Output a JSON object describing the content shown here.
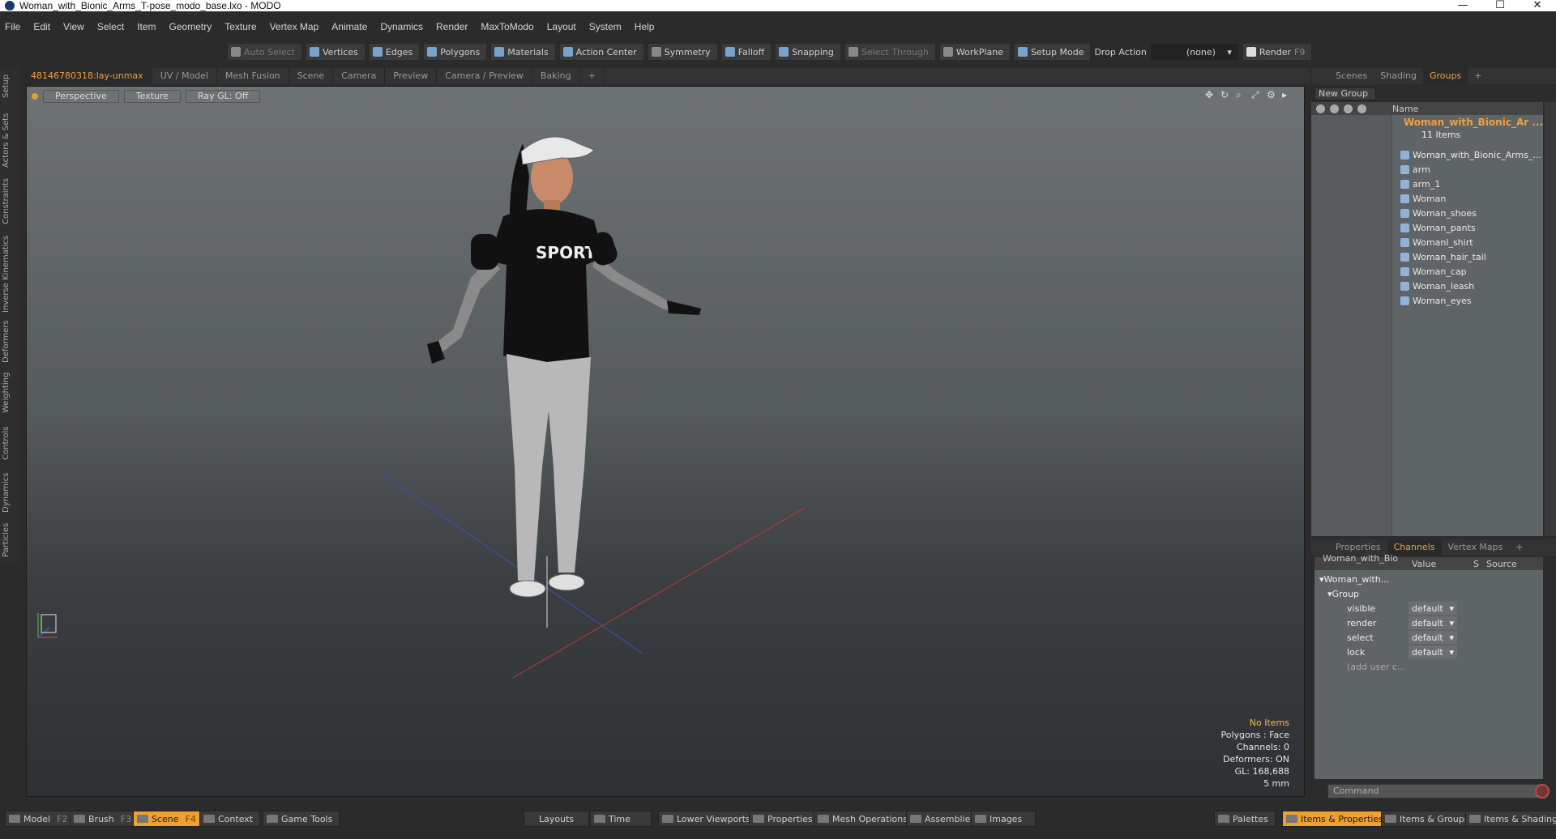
{
  "window": {
    "title": "Woman_with_Bionic_Arms_T-pose_modo_base.lxo - MODO",
    "min": "—",
    "max": "☐",
    "close": "✕"
  },
  "menu": [
    "File",
    "Edit",
    "View",
    "Select",
    "Item",
    "Geometry",
    "Texture",
    "Vertex Map",
    "Animate",
    "Dynamics",
    "Render",
    "MaxToModo",
    "Layout",
    "System",
    "Help"
  ],
  "toolbar": {
    "auto_select": "Auto Select",
    "vertices": "Vertices",
    "edges": "Edges",
    "polygons": "Polygons",
    "materials": "Materials",
    "action_center": "Action Center",
    "symmetry": "Symmetry",
    "falloff": "Falloff",
    "snapping": "Snapping",
    "select_through": "Select Through",
    "workplane": "WorkPlane",
    "setup_mode": "Setup Mode",
    "drop_action": "Drop Action",
    "drop_value": "(none)",
    "render": "Render",
    "render_key": "F9"
  },
  "left_tabs": [
    "Setup",
    "Actors & Sets",
    "Constraints",
    "Inverse Kinematics",
    "Deformers",
    "Weighting",
    "Controls",
    "Dynamics",
    "Particles"
  ],
  "viewport_tabs": [
    "48146780318:lay-unmax",
    "UV / Model",
    "Mesh Fusion",
    "Scene",
    "Camera",
    "Preview",
    "Camera / Preview",
    "Baking",
    "+"
  ],
  "viewport": {
    "perspective": "Perspective",
    "texture": "Texture",
    "ray_gl": "Ray GL: Off",
    "stats": {
      "no_items": "No Items",
      "polygons": "Polygons : Face",
      "channels": "Channels: 0",
      "deformers": "Deformers: ON",
      "gl": "GL: 168,688",
      "scale": "5 mm"
    }
  },
  "right_tabs": [
    "Scenes",
    "Shading",
    "Groups",
    "+"
  ],
  "groups": {
    "new_group": "New Group",
    "name_col": "Name",
    "root": "Woman_with_Bionic_Ar ...",
    "count": "11 Items",
    "items": [
      "Woman_with_Bionic_Arms_...",
      "arm",
      "arm_1",
      "Woman",
      "Woman_shoes",
      "Woman_pants",
      "Womanl_shirt",
      "Woman_hair_tail",
      "Woman_cap",
      "Woman_leash",
      "Woman_eyes"
    ]
  },
  "channel_tabs": [
    "Properties",
    "Channels",
    "Vertex Maps",
    "+"
  ],
  "channels": {
    "col_item": "Woman_with_Bio ...",
    "col_value": "Value",
    "col_s": "S",
    "col_source": "Source",
    "root": "Woman_with...",
    "group": "Group",
    "rows": [
      {
        "name": "visible",
        "value": "default"
      },
      {
        "name": "render",
        "value": "default"
      },
      {
        "name": "select",
        "value": "default"
      },
      {
        "name": "lock",
        "value": "default"
      }
    ],
    "add_user": "(add user c...",
    "command_placeholder": "Command"
  },
  "bottom": {
    "model": "Model",
    "model_key": "F2",
    "brush": "Brush",
    "brush_key": "F3",
    "scene": "Scene",
    "scene_key": "F4",
    "context": "Context",
    "game_tools": "Game Tools",
    "layouts": "Layouts",
    "time": "Time",
    "lower_viewports": "Lower Viewports",
    "properties": "Properties",
    "mesh_operations": "Mesh Operations",
    "assemblies": "Assemblies",
    "images": "Images",
    "palettes": "Palettes",
    "items_properties": "Items & Properties",
    "items_groups": "Items & Groups",
    "items_shading": "Items & Shading"
  }
}
